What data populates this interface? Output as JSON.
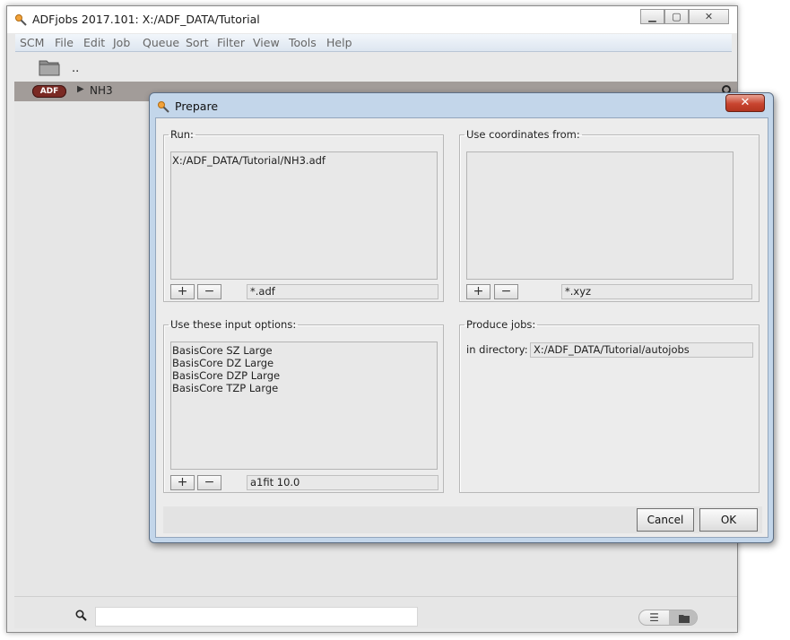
{
  "main_window": {
    "title": "ADFjobs 2017.101: X:/ADF_DATA/Tutorial",
    "menu": [
      "SCM",
      "File",
      "Edit",
      "Job",
      "Queue",
      "Sort",
      "Filter",
      "View",
      "Tools",
      "Help"
    ],
    "parent_dir": "..",
    "job": {
      "badge": "ADF",
      "name": "NH3"
    },
    "search": {
      "value": "",
      "placeholder": ""
    }
  },
  "dialog": {
    "title": "Prepare",
    "run": {
      "legend": "Run:",
      "items": [
        "X:/ADF_DATA/Tutorial/NH3.adf"
      ],
      "add_label": "+",
      "remove_label": "−",
      "filter": "*.adf"
    },
    "coordinates": {
      "legend": "Use coordinates from:",
      "items": [],
      "add_label": "+",
      "remove_label": "−",
      "filter": "*.xyz"
    },
    "input_options": {
      "legend": "Use these input options:",
      "items": [
        "BasisCore SZ Large",
        "BasisCore DZ Large",
        "BasisCore DZP Large",
        "BasisCore TZP Large"
      ],
      "add_label": "+",
      "remove_label": "−",
      "filter": "a1fit 10.0"
    },
    "produce_jobs": {
      "legend": "Produce jobs:",
      "directory_label": "in directory:",
      "directory": "X:/ADF_DATA/Tutorial/autojobs"
    },
    "cancel_label": "Cancel",
    "ok_label": "OK",
    "close_glyph": "✕"
  },
  "colors": {
    "dialog_frame": "#c3d6ea",
    "job_row": "#a29c99",
    "adf_badge": "#7a2a24",
    "close_button": "#c8442f"
  }
}
